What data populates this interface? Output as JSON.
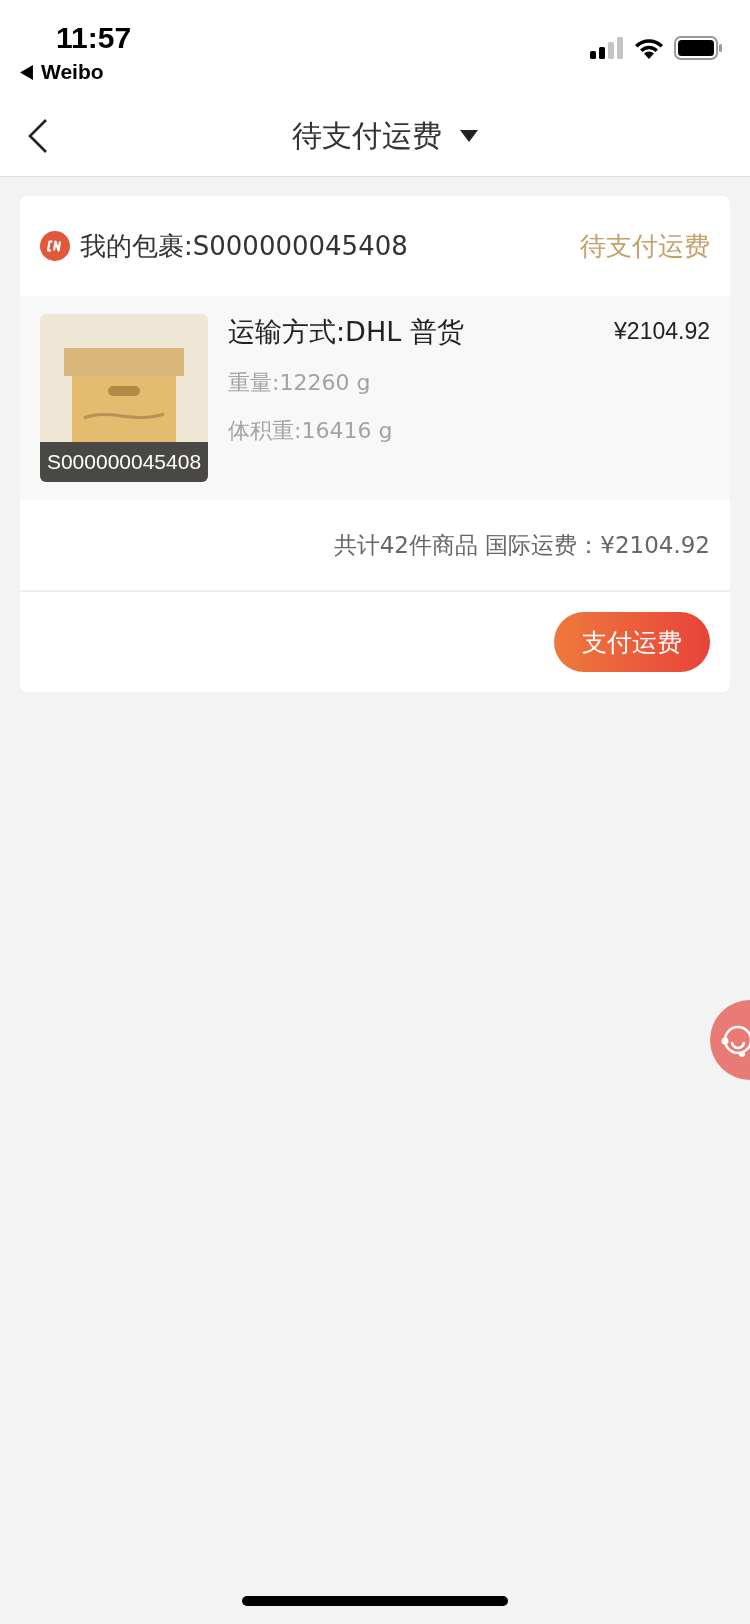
{
  "status_bar": {
    "time": "11:57",
    "back_app": "Weibo"
  },
  "nav": {
    "title": "待支付运费"
  },
  "package": {
    "title": "我的包裹:S000000045408",
    "status": "待支付运费",
    "item": {
      "image_caption": "S000000045408",
      "shipping_method": "运输方式:DHL 普货",
      "weight": "重量:12260 g",
      "volumetric_weight": "体积重:16416 g",
      "price": "¥2104.92"
    },
    "summary": "共计42件商品 国际运费：¥2104.92",
    "pay_button": "支付运费"
  }
}
